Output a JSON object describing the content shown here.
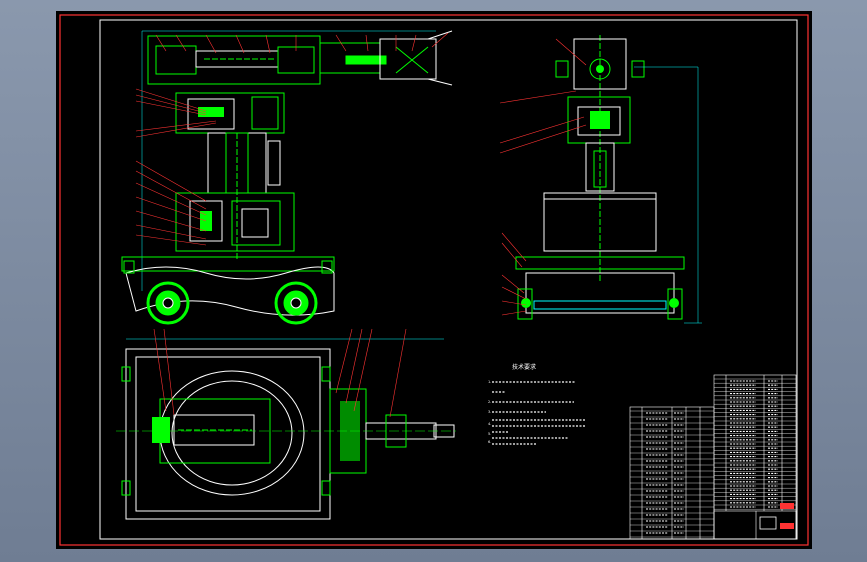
{
  "app": {
    "title": ""
  },
  "colors": {
    "background": "#000000",
    "frame": "#ffffff",
    "border": "#ff0000",
    "part": "#00ff00",
    "leader": "#ff0000",
    "outline": "#ffffff",
    "dim": "#00ffff",
    "text": "#ffffff",
    "stamp": "#ff0000"
  },
  "tech_requirements": {
    "title": "技术要求",
    "lines": [
      "1.",
      "2.",
      "3.",
      "4.",
      "5.",
      "6."
    ]
  },
  "icons": [
    "wheel-icon",
    "title-block-stamp-icon"
  ]
}
